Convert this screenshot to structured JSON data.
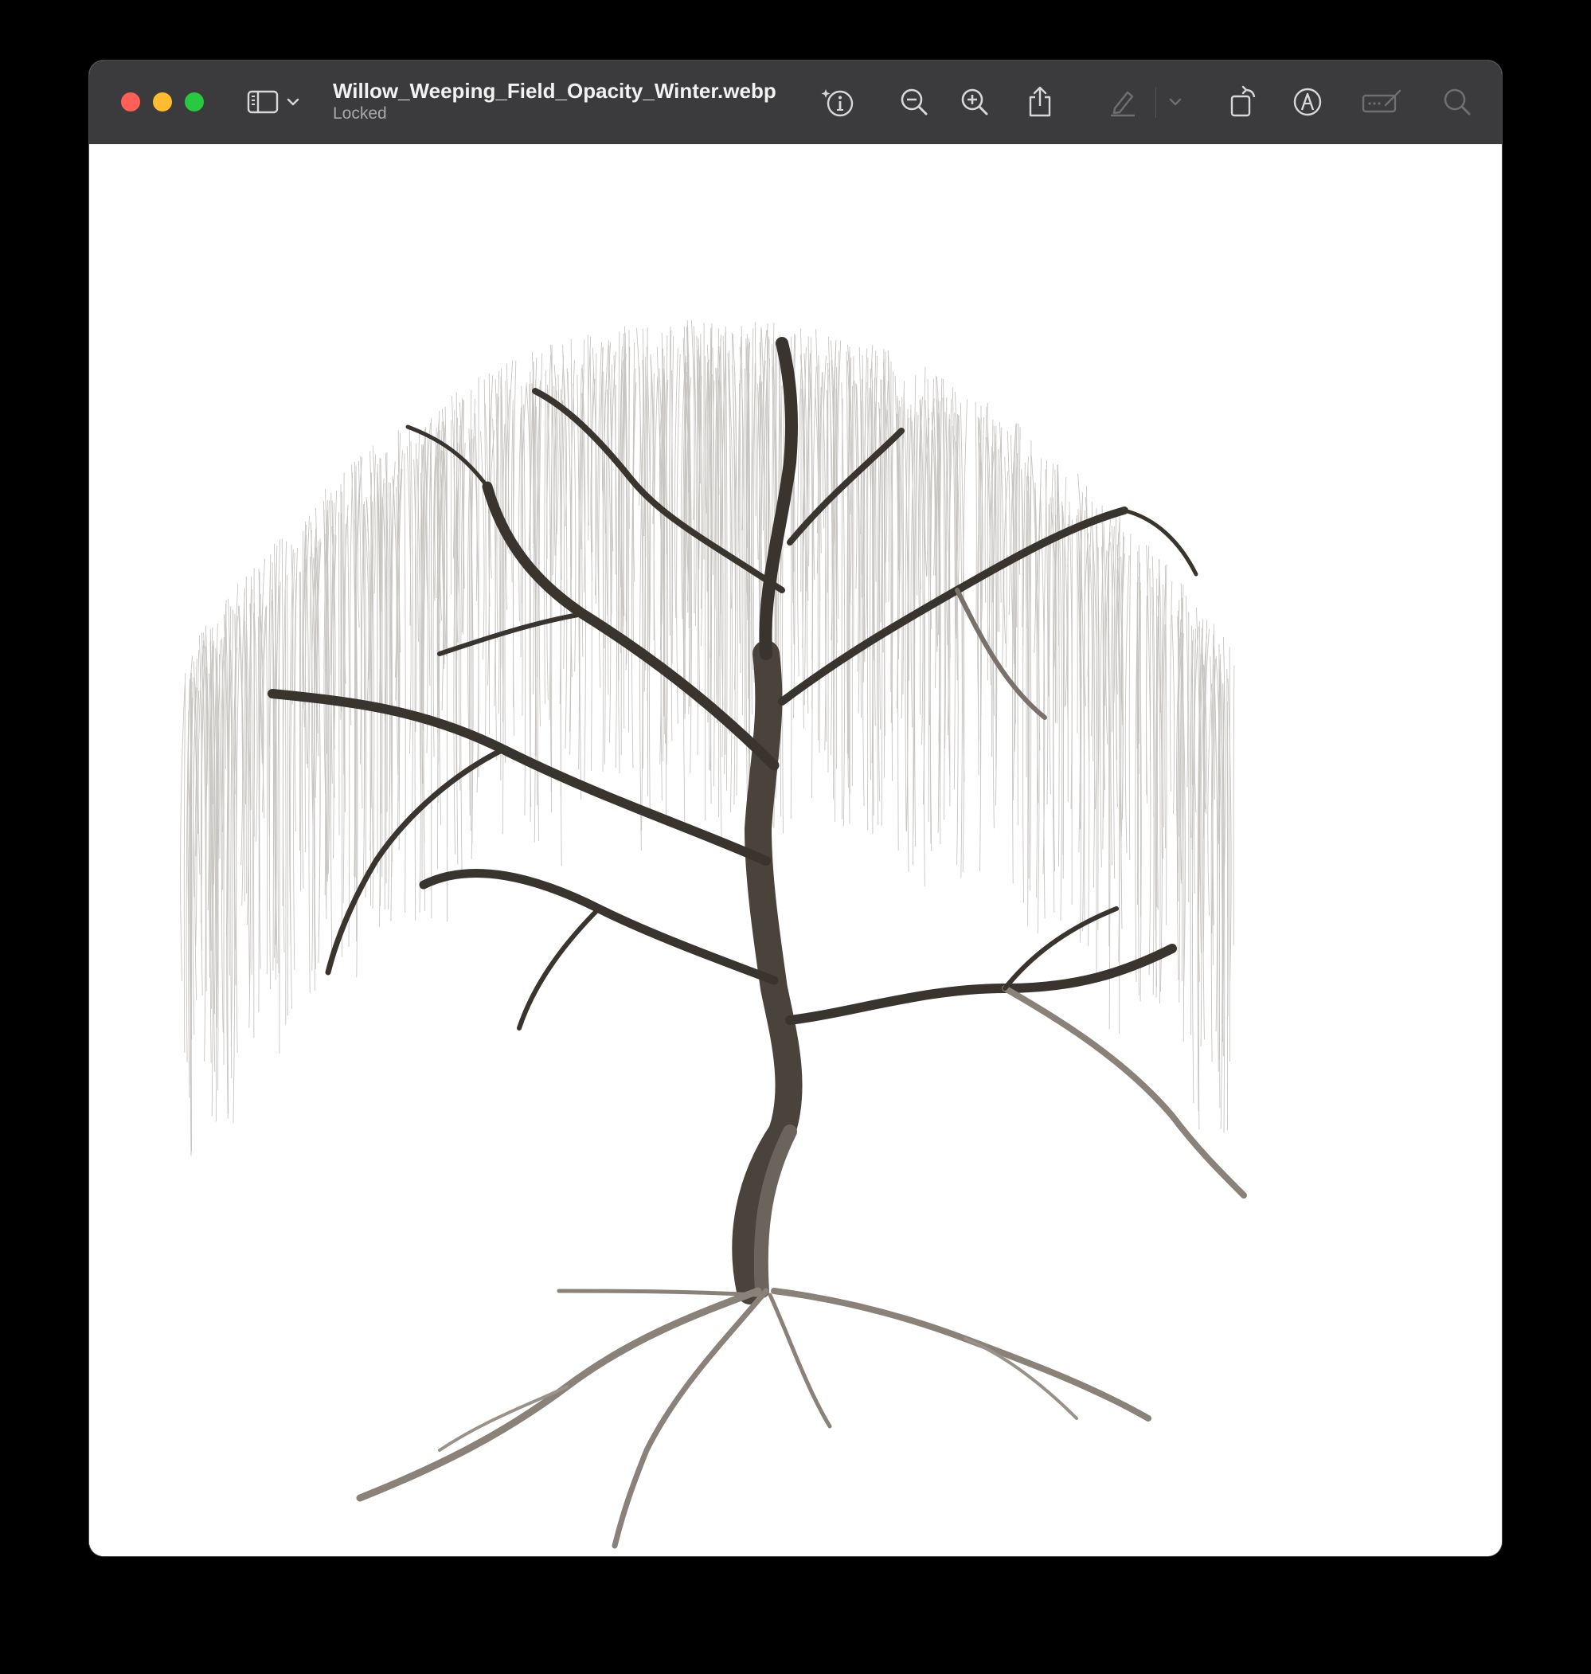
{
  "window": {
    "title": "Willow_Weeping_Field_Opacity_Winter.webp",
    "subtitle": "Locked"
  },
  "toolbar": {
    "icons": [
      "sidebar-icon",
      "chevron-down-icon",
      "info-icon",
      "zoom-out-icon",
      "zoom-in-icon",
      "share-icon",
      "highlight-icon",
      "rotate-icon",
      "markup-icon",
      "form-fill-icon",
      "search-icon"
    ]
  },
  "colors": {
    "titlebar": "#3b3b3d",
    "close": "#ff5f57",
    "minimize": "#febc2e",
    "maximize": "#28c840",
    "icon": "#d8d8d8",
    "icon_disabled": "#6f6f6f"
  },
  "image": {
    "subject": "weeping-willow-tree"
  }
}
